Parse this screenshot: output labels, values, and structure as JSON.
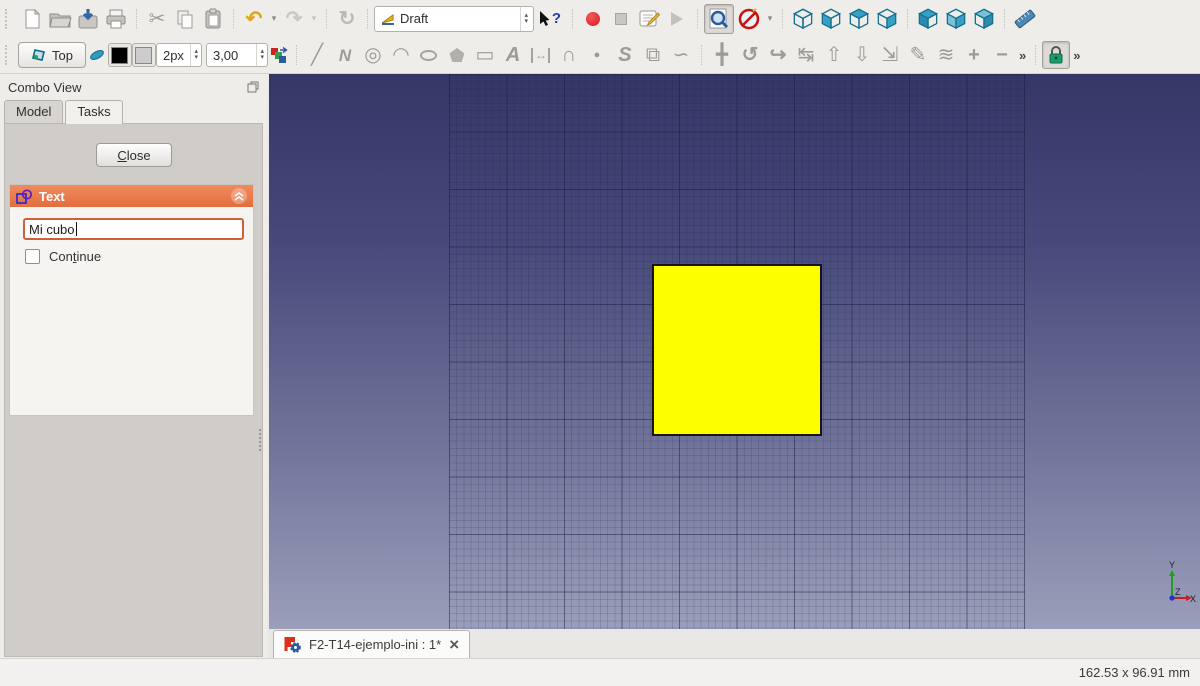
{
  "workbench_selector": {
    "selected": "Draft"
  },
  "toolbar_draft": {
    "top_button_label": "Top",
    "line_width_value": "2px",
    "font_size_value": "3,00"
  },
  "icons": {
    "cut": "✂",
    "undo": "↶",
    "redo": "↷",
    "refresh": "↻",
    "dropdown": "▾",
    "spin_up": "▴",
    "spin_down": "▾",
    "whatsthis_q": "?",
    "overflow": "»",
    "tool_line": "╱",
    "tool_wire": "N",
    "tool_circle": "◎",
    "tool_arc": "◠",
    "tool_rectangle": "▭",
    "tool_text": "A",
    "tool_dimension_arrow": "↔",
    "tool_bspline": "∩",
    "tool_point": "●",
    "tool_shapestring": "S",
    "tool_facebinder": "⧉",
    "tool_bezier": "∽",
    "tool_move": "╋",
    "tool_rotate": "↺",
    "tool_offset": "↪",
    "tool_trimex": "↹",
    "tool_upgrade": "⇧",
    "tool_downgrade": "⇩",
    "tool_scale": "⇲",
    "tool_edit": "✎",
    "tool_join": "≋",
    "tool_addpoint": "+",
    "tool_delpoint": "−",
    "tab_close": "×"
  },
  "combo_view": {
    "title": "Combo View",
    "tab_model": "Model",
    "tab_tasks": "Tasks"
  },
  "tasks": {
    "close_accel": "C",
    "close_rest": "lose",
    "panel_title": "Text",
    "input_value": "Mi cubo",
    "continue_pre": "Con",
    "continue_accel": "t",
    "continue_rest": "inue",
    "continue_checked": false
  },
  "viewport": {
    "axis_x": "X",
    "axis_y": "Y",
    "axis_z": "Z",
    "object": "yellow rectangle (Mi cubo draft rectangle)"
  },
  "doc_tab": {
    "title": "F2-T14-ejemplo-ini : 1*"
  },
  "status_bar": {
    "size_readout": "162.53 x 96.91 mm"
  },
  "colors": {
    "accent_orange": "#e4703f",
    "viewport_top": "#343766",
    "viewport_bottom": "#9b9eba",
    "grid_line": "#161a3a",
    "rectangle_fill": "#fdff00",
    "rectangle_border": "#141414",
    "axis_x_color": "#cc2222",
    "axis_y_color": "#22aa22",
    "axis_z_color": "#2233cc"
  }
}
